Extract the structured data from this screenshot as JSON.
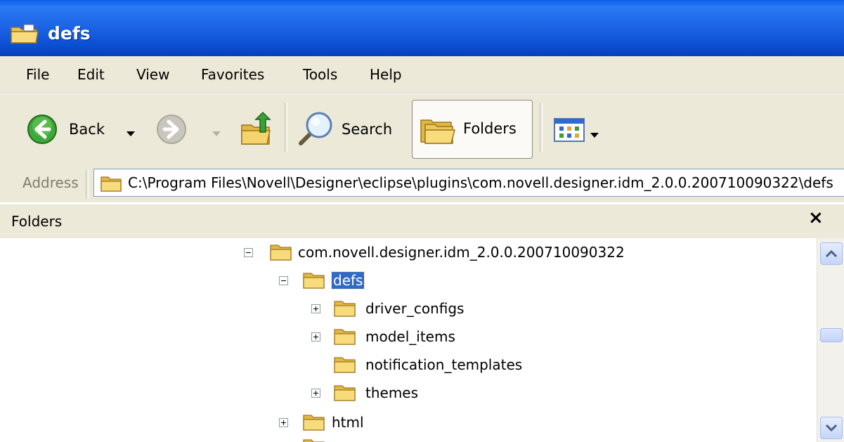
{
  "window": {
    "title": "defs"
  },
  "menu": [
    "File",
    "Edit",
    "View",
    "Favorites",
    "Tools",
    "Help"
  ],
  "toolbar": {
    "back_label": "Back",
    "search_label": "Search",
    "folders_label": "Folders"
  },
  "address": {
    "label": "Address",
    "value": "C:\\Program Files\\Novell\\Designer\\eclipse\\plugins\\com.novell.designer.idm_2.0.0.200710090322\\defs"
  },
  "pane": {
    "title": "Folders",
    "close_label": "×"
  },
  "tree": {
    "root": "com.novell.designer.idm_2.0.0.200710090322",
    "selected": "defs",
    "children": [
      "driver_configs",
      "model_items",
      "notification_templates",
      "themes"
    ],
    "sibling": "html"
  },
  "colors": {
    "titlebar": "#0b4fd4",
    "selection": "#316ac5",
    "chrome": "#ece9d8"
  }
}
